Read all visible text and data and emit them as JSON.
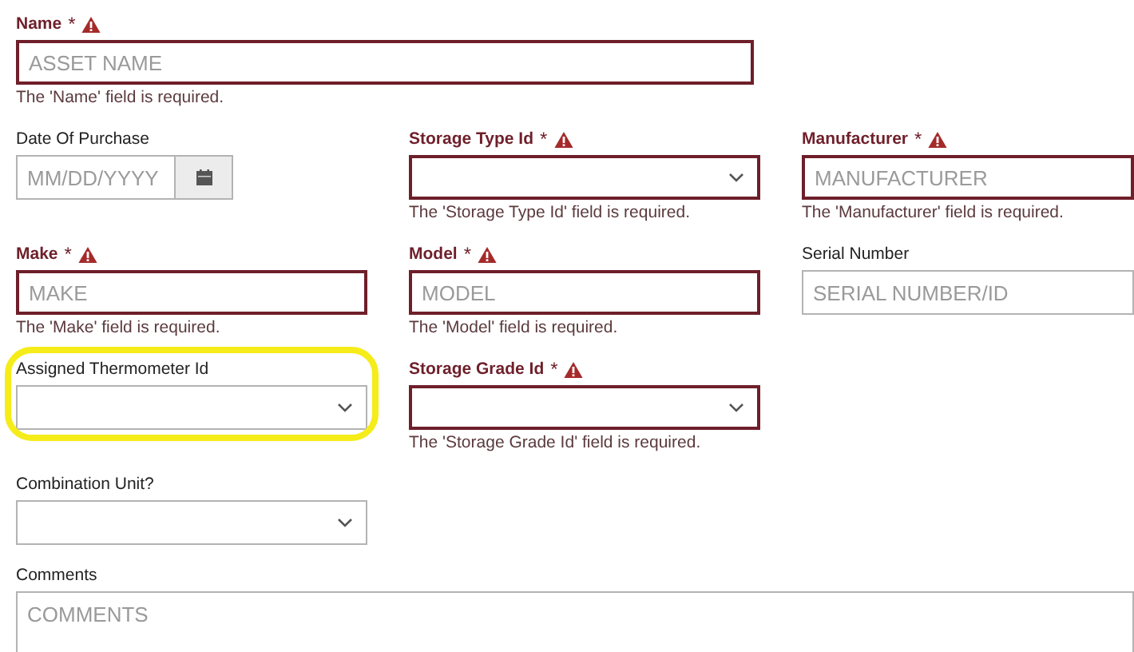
{
  "rows": [
    [
      {
        "label": "Name",
        "required": true,
        "mark": "*",
        "kind": "text",
        "placeholder": "ASSET NAME",
        "error": "The 'Name' field is required."
      }
    ],
    [
      {
        "label": "Date Of Purchase",
        "required": false,
        "kind": "date",
        "placeholder": "MM/DD/YYYY"
      },
      {
        "label": "Storage Type Id",
        "required": true,
        "mark": "*",
        "kind": "select",
        "error": "The 'Storage Type Id' field is required."
      },
      {
        "label": "Manufacturer",
        "required": true,
        "mark": "*",
        "kind": "text",
        "placeholder": "MANUFACTURER",
        "error": "The 'Manufacturer' field is required."
      }
    ],
    [
      {
        "label": "Make",
        "required": true,
        "mark": "*",
        "kind": "text",
        "placeholder": "MAKE",
        "error": "The 'Make' field is required."
      },
      {
        "label": "Model",
        "required": true,
        "mark": "*",
        "kind": "text",
        "placeholder": "MODEL",
        "error": "The 'Model' field is required."
      },
      {
        "label": "Serial Number",
        "required": false,
        "kind": "text",
        "placeholder": "SERIAL NUMBER/ID"
      }
    ],
    [
      {
        "label": "Assigned Thermometer Id",
        "required": false,
        "kind": "select",
        "highlighted": true
      },
      {
        "label": "Storage Grade Id",
        "required": true,
        "mark": "*",
        "kind": "select",
        "error": "The 'Storage Grade Id' field is required."
      }
    ],
    [
      {
        "label": "Combination Unit?",
        "required": false,
        "kind": "select"
      }
    ],
    [
      {
        "label": "Comments",
        "required": false,
        "kind": "textarea",
        "placeholder": "COMMENTS"
      }
    ]
  ]
}
